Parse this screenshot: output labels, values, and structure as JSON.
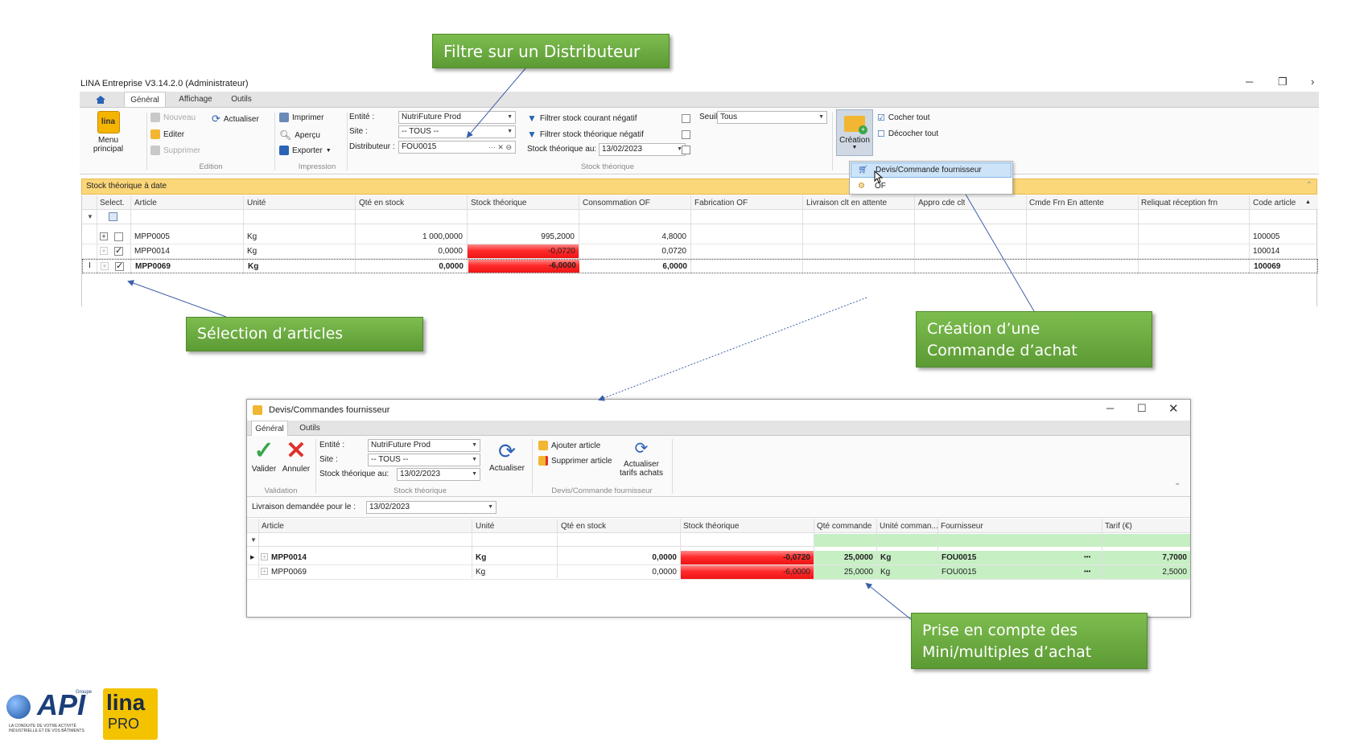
{
  "callouts": {
    "filter": "Filtre sur un Distributeur",
    "selection": "Sélection d’articles",
    "creation_line1": "Création d’une",
    "creation_line2": "Commande d’achat",
    "mini_line1": "Prise en compte des",
    "mini_line2": "Mini/multiples d’achat"
  },
  "main": {
    "title": "LINA Entreprise  V3.14.2.0  (Administrateur)",
    "tabs": [
      "Général",
      "Affichage",
      "Outils"
    ],
    "menu_principal": "Menu principal",
    "edition": {
      "nouveau": "Nouveau",
      "editer": "Editer",
      "supprimer": "Supprimer",
      "actualiser": "Actualiser",
      "label": "Edition"
    },
    "impression": {
      "imprimer": "Imprimer",
      "apercu": "Aperçu",
      "exporter": "Exporter",
      "label": "Impression"
    },
    "stock": {
      "entite_label": "Entité :",
      "entite_value": "NutriFuture Prod",
      "site_label": "Site :",
      "site_value": "-- TOUS --",
      "distributeur_label": "Distributeur :",
      "distributeur_value": "FOU0015",
      "filtre_courant": "Filtrer stock courant négatif",
      "filtre_theorique": "Filtrer stock théorique négatif",
      "stock_au_label": "Stock théorique au:",
      "stock_au_value": "13/02/2023",
      "seuil_label": "Seuil",
      "seuil_value": "Tous",
      "label": "Stock théorique"
    },
    "creation": "Création",
    "cocher": "Cocher tout",
    "decocher": "Décocher tout",
    "dropdown": {
      "item1": "Devis/Commande fournisseur",
      "item2": "OF"
    },
    "panel_title": "Stock théorique à date",
    "columns": [
      "Select.",
      "Article",
      "Unité",
      "Qté en stock",
      "Stock théorique",
      "Consommation OF",
      "Fabrication OF",
      "Livraison clt en attente",
      "Appro cde clt",
      "Cmde Frn En attente",
      "Reliquat réception frn",
      "Code article"
    ],
    "rows": [
      {
        "article": "MPP0005",
        "unite": "Kg",
        "qte": "1 000,0000",
        "stock": "995,2000",
        "conso": "4,8000",
        "code": "100005"
      },
      {
        "article": "MPP0014",
        "unite": "Kg",
        "qte": "0,0000",
        "stock": "-0,0720",
        "conso": "0,0720",
        "code": "100014"
      },
      {
        "article": "MPP0069",
        "unite": "Kg",
        "qte": "0,0000",
        "stock": "-6,0000",
        "conso": "6,0000",
        "code": "100069"
      }
    ]
  },
  "dialog": {
    "title": "Devis/Commandes fournisseur",
    "tabs": [
      "Général",
      "Outils"
    ],
    "valider": "Valider",
    "annuler": "Annuler",
    "validation_label": "Validation",
    "entite_label": "Entité :",
    "entite_value": "NutriFuture Prod",
    "site_label": "Site :",
    "site_value": "-- TOUS --",
    "stock_au_label": "Stock théorique au:",
    "stock_au_value": "13/02/2023",
    "stock_group_label": "Stock théorique",
    "actualiser": "Actualiser",
    "ajouter": "Ajouter article",
    "supprimer": "Supprimer article",
    "actualiser_tarifs_1": "Actualiser",
    "actualiser_tarifs_2": "tarifs achats",
    "devis_group_label": "Devis/Commande fournisseur",
    "livraison_label": "Livraison demandée pour le :",
    "livraison_value": "13/02/2023",
    "columns": [
      "Article",
      "Unité",
      "Qté en stock",
      "Stock théorique",
      "Qté commande",
      "Unité comman...",
      "Fournisseur",
      "Tarif (€)"
    ],
    "rows": [
      {
        "article": "MPP0014",
        "unite": "Kg",
        "qte": "0,0000",
        "stock": "-0,0720",
        "qte_cmd": "25,0000",
        "unite_cmd": "Kg",
        "fournisseur": "FOU0015",
        "dots": "•••",
        "tarif": "7,7000"
      },
      {
        "article": "MPP0069",
        "unite": "Kg",
        "qte": "0,0000",
        "stock": "-6,0000",
        "qte_cmd": "25,0000",
        "unite_cmd": "Kg",
        "fournisseur": "FOU0015",
        "dots": "•••",
        "tarif": "2,5000"
      }
    ]
  },
  "logo": {
    "api": "API",
    "groupe": "Groupe",
    "tagline": "LA CONDUITE DE VOTRE ACTIVITÉ INDUSTRIELLE ET DE VOS BÂTIMENTS",
    "lina": "lina",
    "pro": "PRO"
  }
}
